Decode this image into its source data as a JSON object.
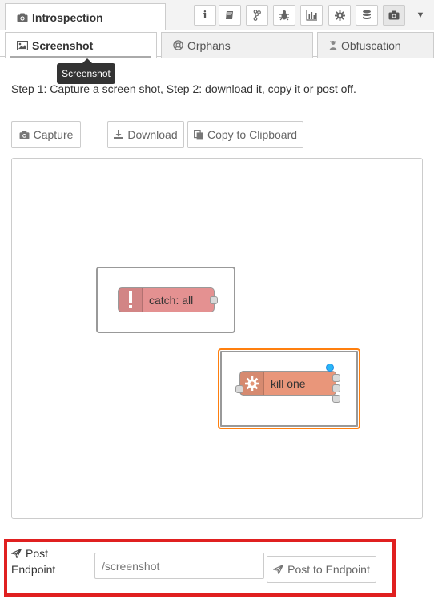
{
  "header": {
    "title": "Introspection",
    "toolbar_icons": [
      "info-icon",
      "book-icon",
      "git-branch-icon",
      "bug-icon",
      "bar-chart-icon",
      "gear-icon",
      "database-icon",
      "camera-icon"
    ],
    "caret": "▼"
  },
  "tabs": [
    {
      "label": "Screenshot",
      "icon": "image-icon",
      "active": true
    },
    {
      "label": "Orphans",
      "icon": "life-ring-icon",
      "active": false
    },
    {
      "label": "Obfuscation",
      "icon": "user-secret-icon",
      "active": false
    }
  ],
  "tooltip": "Screenshot",
  "instructions": "Step 1: Capture a screen shot, Step 2: download it, copy it or post off.",
  "buttons": {
    "capture": "Capture",
    "download": "Download",
    "copy": "Copy to Clipboard"
  },
  "flow": {
    "nodes": [
      {
        "label": "catch: all",
        "type": "catch",
        "color": "#e49191",
        "icon": "exclamation-icon"
      },
      {
        "label": "kill one",
        "type": "function",
        "color": "#e9967a",
        "icon": "gear-icon"
      }
    ]
  },
  "post": {
    "label_line1": "Post",
    "label_line2": "Endpoint",
    "placeholder": "/screenshot",
    "button": "Post to Endpoint"
  },
  "colors": {
    "highlight_box": "#e02020",
    "selection": "#ff7f0e",
    "status_dot": "#29b6f6"
  }
}
